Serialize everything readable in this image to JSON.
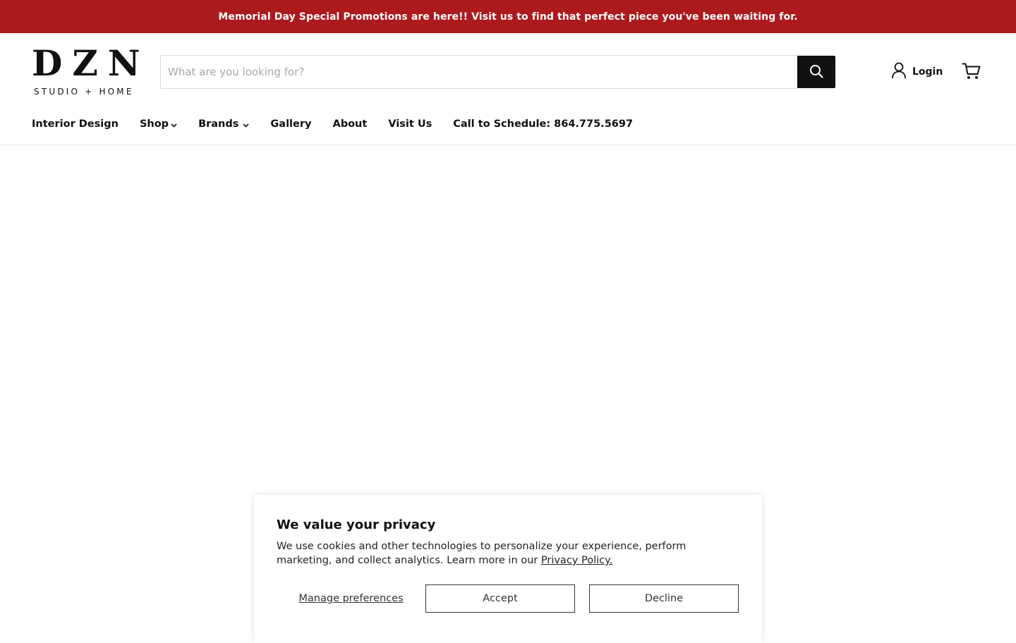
{
  "announcement": {
    "text": "Memorial Day Special Promotions are here!! Visit us to find that perfect piece you've been waiting for.",
    "background": "#ac1a1d"
  },
  "logo": {
    "main": "DZN",
    "sub": "STUDIO + HOME"
  },
  "search": {
    "placeholder": "What are you looking for?",
    "value": "",
    "button_icon": "search-icon"
  },
  "account": {
    "login_label": "Login",
    "icon": "user-icon"
  },
  "cart": {
    "icon": "cart-icon"
  },
  "nav": {
    "items": [
      {
        "label": "Interior Design",
        "dropdown": false
      },
      {
        "label": "Shop",
        "dropdown": true
      },
      {
        "label": "Brands",
        "dropdown": true
      },
      {
        "label": "Gallery",
        "dropdown": false
      },
      {
        "label": "About",
        "dropdown": false
      },
      {
        "label": "Visit Us",
        "dropdown": false
      },
      {
        "label": "Call to Schedule: 864.775.5697",
        "dropdown": false
      }
    ]
  },
  "privacy": {
    "title": "We value your privacy",
    "body": "We use cookies and other technologies to personalize your experience, perform marketing, and collect analytics. Learn more in our ",
    "link": "Privacy Policy.",
    "manage_label": "Manage preferences",
    "accept_label": "Accept",
    "decline_label": "Decline"
  }
}
